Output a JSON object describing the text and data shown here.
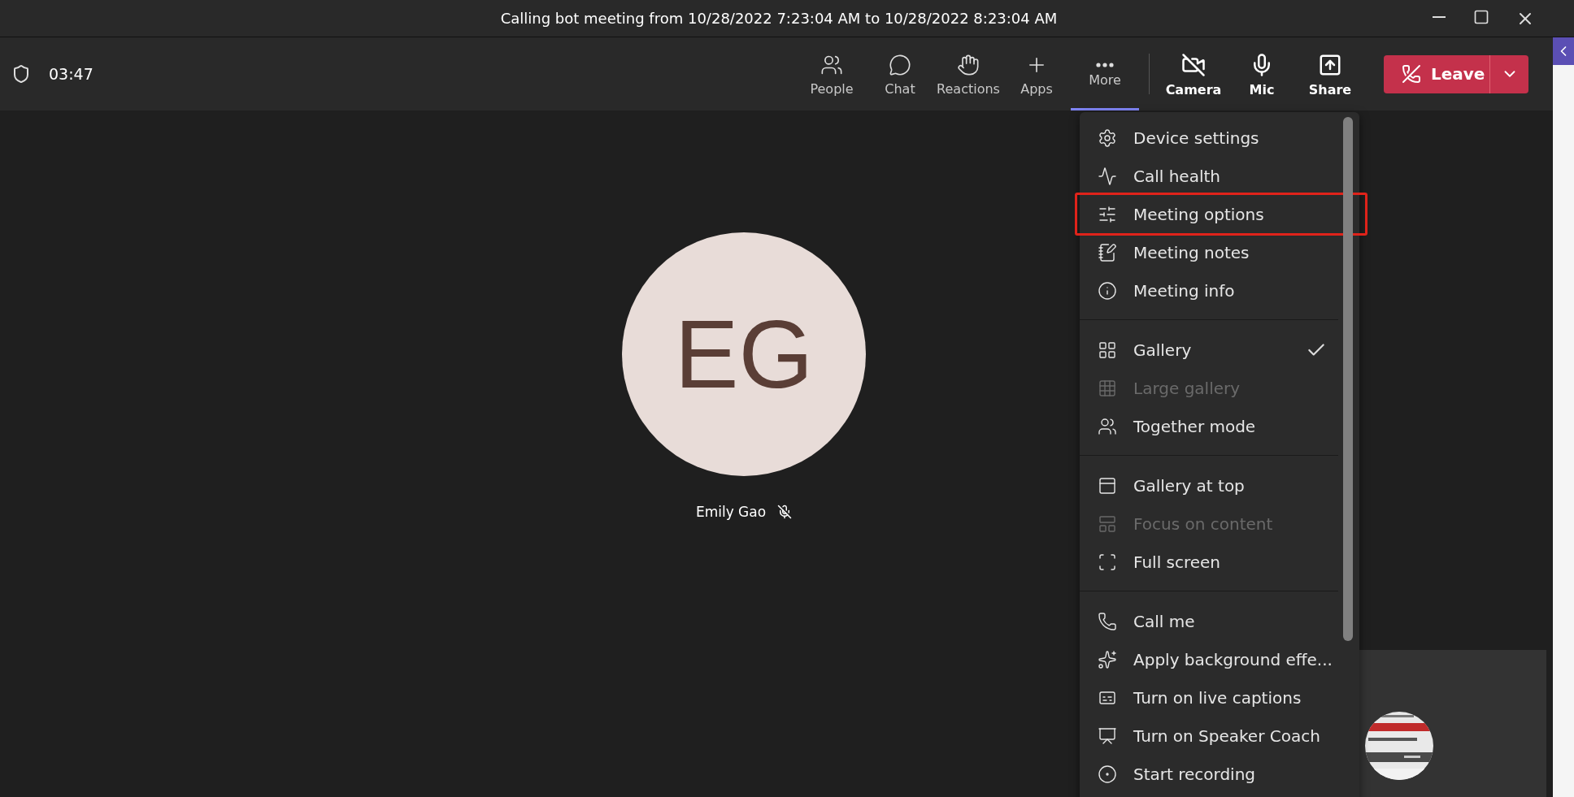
{
  "window": {
    "title": "Calling bot meeting from 10/28/2022 7:23:04 AM to 10/28/2022 8:23:04 AM"
  },
  "toolbar": {
    "timer": "03:47",
    "view_controls": [
      {
        "label": "People",
        "selected": false
      },
      {
        "label": "Chat",
        "selected": false
      },
      {
        "label": "Reactions",
        "selected": false
      },
      {
        "label": "Apps",
        "selected": false
      },
      {
        "label": "More",
        "selected": true
      }
    ],
    "device_controls": [
      {
        "label": "Camera"
      },
      {
        "label": "Mic"
      },
      {
        "label": "Share"
      }
    ],
    "leave_button": {
      "label": "Leave"
    }
  },
  "participant": {
    "initials": "EG",
    "name": "Emily Gao",
    "muted": true
  },
  "more_menu": {
    "groups": [
      [
        {
          "label": "Device settings",
          "disabled": false,
          "checked": false,
          "highlighted": false
        },
        {
          "label": "Call health",
          "disabled": false,
          "checked": false,
          "highlighted": false
        },
        {
          "label": "Meeting options",
          "disabled": false,
          "checked": false,
          "highlighted": true
        },
        {
          "label": "Meeting notes",
          "disabled": false,
          "checked": false,
          "highlighted": false
        },
        {
          "label": "Meeting info",
          "disabled": false,
          "checked": false,
          "highlighted": false
        }
      ],
      [
        {
          "label": "Gallery",
          "disabled": false,
          "checked": true,
          "highlighted": false
        },
        {
          "label": "Large gallery",
          "disabled": true,
          "checked": false,
          "highlighted": false
        },
        {
          "label": "Together mode",
          "disabled": false,
          "checked": false,
          "highlighted": false
        }
      ],
      [
        {
          "label": "Gallery at top",
          "disabled": false,
          "checked": false,
          "highlighted": false
        },
        {
          "label": "Focus on content",
          "disabled": true,
          "checked": false,
          "highlighted": false
        },
        {
          "label": "Full screen",
          "disabled": false,
          "checked": false,
          "highlighted": false
        }
      ],
      [
        {
          "label": "Call me",
          "disabled": false,
          "checked": false,
          "highlighted": false
        },
        {
          "label": "Apply background effe...",
          "disabled": false,
          "checked": false,
          "highlighted": false
        },
        {
          "label": "Turn on live captions",
          "disabled": false,
          "checked": false,
          "highlighted": false
        },
        {
          "label": "Turn on Speaker Coach",
          "disabled": false,
          "checked": false,
          "highlighted": false
        },
        {
          "label": "Start recording",
          "disabled": false,
          "checked": false,
          "highlighted": false
        }
      ]
    ]
  }
}
